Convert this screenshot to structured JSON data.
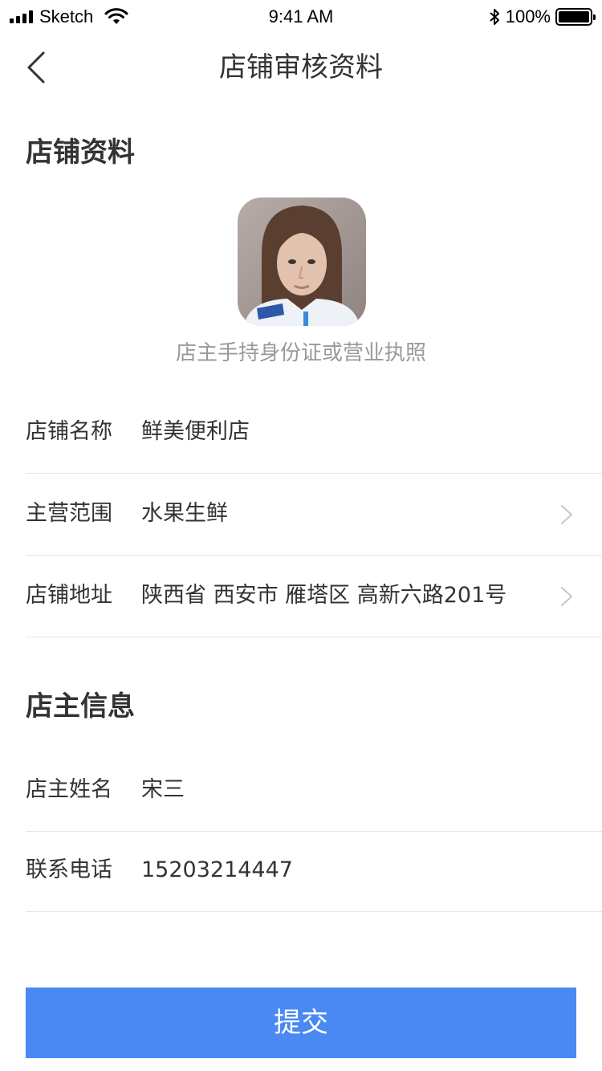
{
  "status_bar": {
    "carrier": "Sketch",
    "time": "9:41 AM",
    "battery": "100%"
  },
  "nav": {
    "title": "店铺审核资料"
  },
  "shop_section": {
    "title": "店铺资料",
    "photo_caption": "店主手持身份证或营业执照",
    "rows": [
      {
        "label": "店铺名称",
        "value": "鲜美便利店"
      },
      {
        "label": "主营范围",
        "value": "水果生鲜"
      },
      {
        "label": "店铺地址",
        "value": "陕西省 西安市 雁塔区 高新六路201号"
      }
    ]
  },
  "owner_section": {
    "title": "店主信息",
    "rows": [
      {
        "label": "店主姓名",
        "value": "宋三"
      },
      {
        "label": "联系电话",
        "value": "15203214447"
      }
    ]
  },
  "submit": {
    "label": "提交"
  },
  "colors": {
    "primary": "#4a89f3",
    "text": "#333333",
    "muted": "#999999",
    "divider": "#e5e5e5"
  },
  "icons": {
    "back": "chevron-left-icon",
    "disclosure": "chevron-right-icon"
  }
}
